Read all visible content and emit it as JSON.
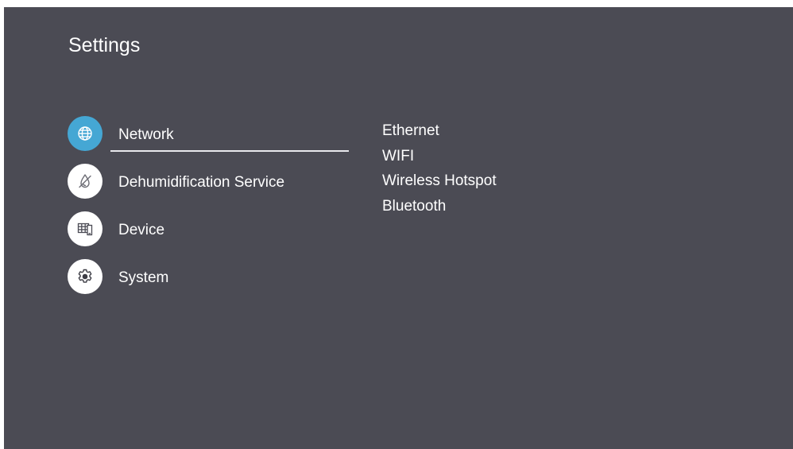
{
  "page": {
    "title": "Settings"
  },
  "colors": {
    "background": "#4b4b54",
    "accent": "#45a7d4",
    "text": "#ffffff"
  },
  "menu": {
    "selected": "Network",
    "items": [
      {
        "label": "Network",
        "icon": "globe-icon"
      },
      {
        "label": "Dehumidification Service",
        "icon": "dehumidifier-icon"
      },
      {
        "label": "Device",
        "icon": "device-icon"
      },
      {
        "label": "System",
        "icon": "gear-icon"
      }
    ]
  },
  "submenu": {
    "items": [
      {
        "label": "Ethernet"
      },
      {
        "label": "WIFI"
      },
      {
        "label": "Wireless Hotspot"
      },
      {
        "label": "Bluetooth"
      }
    ]
  }
}
